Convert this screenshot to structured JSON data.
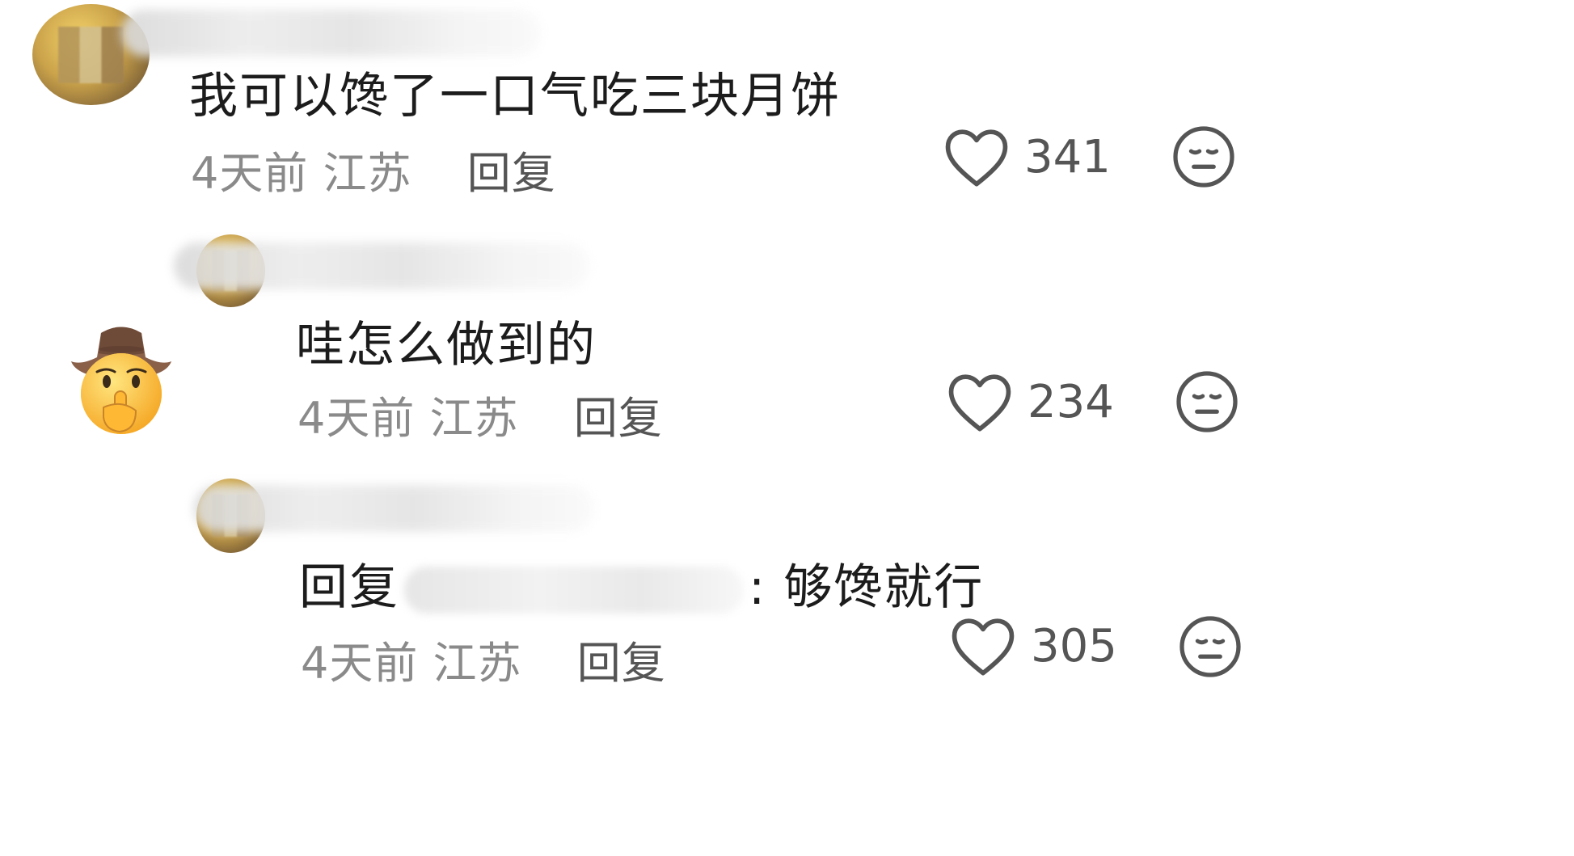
{
  "comments": [
    {
      "text": "我可以馋了一口气吃三块月饼",
      "time": "4天前",
      "location": "江苏",
      "reply_label": "回复",
      "likes": "341",
      "like_icon": "heart-outline-icon",
      "dislike_icon": "neutral-face-icon"
    },
    {
      "text": "哇怎么做到的",
      "time": "4天前",
      "location": "江苏",
      "reply_label": "回复",
      "likes": "234",
      "like_icon": "heart-outline-icon",
      "dislike_icon": "neutral-face-icon"
    },
    {
      "reply_prefix": "回复",
      "text": ": 够馋就行",
      "time": "4天前",
      "location": "江苏",
      "reply_label": "回复",
      "likes": "305",
      "like_icon": "heart-outline-icon",
      "dislike_icon": "neutral-face-icon"
    }
  ],
  "sticker": "cowboy-shushing-emoji",
  "colors": {
    "text": "#1c1c1c",
    "meta": "#8a8a8a",
    "icon": "#555555"
  }
}
